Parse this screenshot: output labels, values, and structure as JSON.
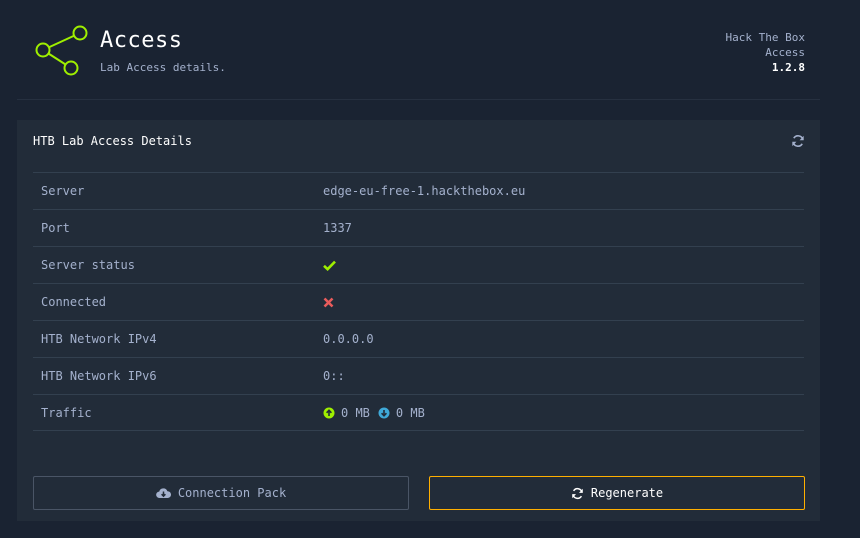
{
  "header": {
    "title": "Access",
    "subtitle": "Lab Access details.",
    "meta_line1": "Hack The Box",
    "meta_line2": "Access",
    "version": "1.2.8"
  },
  "panel": {
    "title": "HTB Lab Access Details",
    "rows": [
      {
        "label": "Server",
        "value": "edge-eu-free-1.hackthebox.eu"
      },
      {
        "label": "Port",
        "value": "1337"
      },
      {
        "label": "Server status",
        "value": ""
      },
      {
        "label": "Connected",
        "value": ""
      },
      {
        "label": "HTB Network IPv4",
        "value": "0.0.0.0"
      },
      {
        "label": "HTB Network IPv6",
        "value": "0::"
      },
      {
        "label": "Traffic",
        "value": ""
      }
    ],
    "server_status_icon": "check-icon",
    "connected_icon": "cross-icon",
    "traffic": {
      "up": "0 MB",
      "down": "0 MB"
    }
  },
  "buttons": {
    "connection_pack": "Connection Pack",
    "regenerate": "Regenerate"
  },
  "colors": {
    "background": "#1a2332",
    "panel": "#222c39",
    "accent_green": "#9fef00",
    "accent_orange": "#ffaf00",
    "error_red": "#ff3e3e",
    "info_blue": "#0086ff"
  }
}
